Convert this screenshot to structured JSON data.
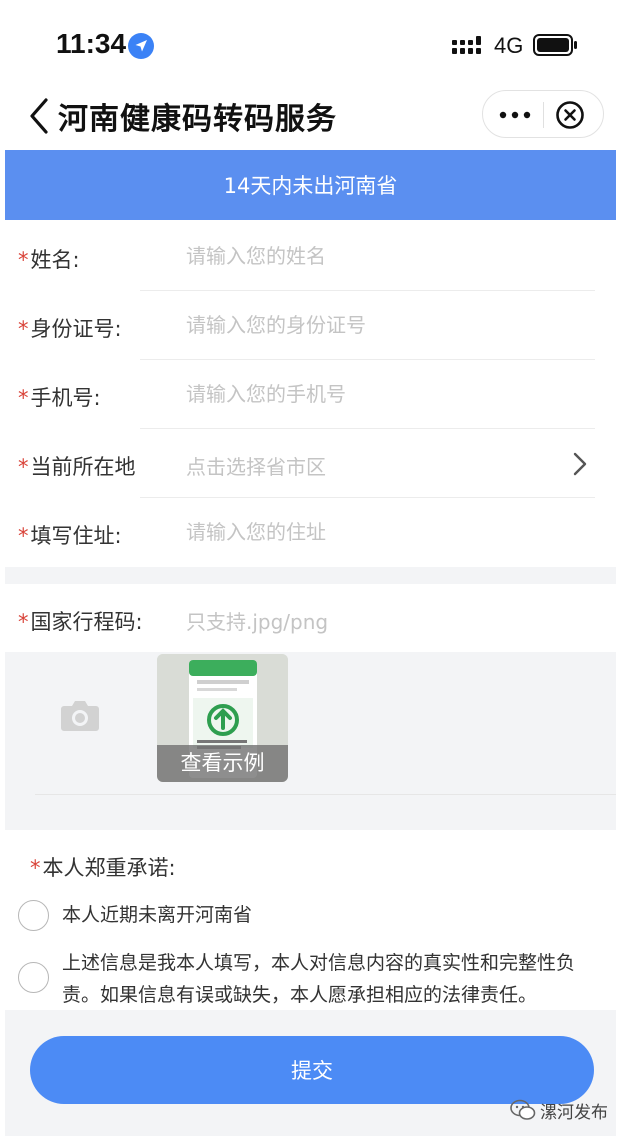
{
  "status_bar": {
    "time": "11:34",
    "network": "4G",
    "icons": [
      "location-arrow-icon",
      "signal-icon",
      "battery-icon"
    ]
  },
  "nav": {
    "title": "河南健康码转码服务",
    "icons": [
      "back-icon",
      "more-icon",
      "close-icon"
    ]
  },
  "banner": {
    "text": "14天内未出河南省",
    "color": "#5b8ff0"
  },
  "form": {
    "required_mark": "*",
    "fields": [
      {
        "label": "姓名:",
        "placeholder": "请输入您的姓名",
        "value": ""
      },
      {
        "label": "身份证号:",
        "placeholder": "请输入您的身份证号",
        "value": ""
      },
      {
        "label": "手机号:",
        "placeholder": "请输入您的手机号",
        "value": ""
      },
      {
        "label": "当前所在地",
        "placeholder": "点击选择省市区",
        "value": ""
      },
      {
        "label": "填写住址:",
        "placeholder": "请输入您的住址",
        "value": ""
      }
    ]
  },
  "itinerary": {
    "label": "国家行程码:",
    "hint": "只支持.jpg/png",
    "sample_caption": "查看示例",
    "icons": [
      "camera-icon"
    ]
  },
  "pledge": {
    "title": "本人郑重承诺:",
    "items": [
      {
        "line1": "本人近期未离开河南省",
        "line2": ""
      },
      {
        "line1": "上述信息是我本人填写，本人对信息内容的真实性和完整性负",
        "line2": "责。如果信息有误或缺失，本人愿承担相应的法律责任。"
      }
    ]
  },
  "submit": {
    "label": "提交",
    "color": "#4c8bf5"
  },
  "watermark": {
    "text": "漯河发布",
    "icon": "wechat-icon"
  }
}
